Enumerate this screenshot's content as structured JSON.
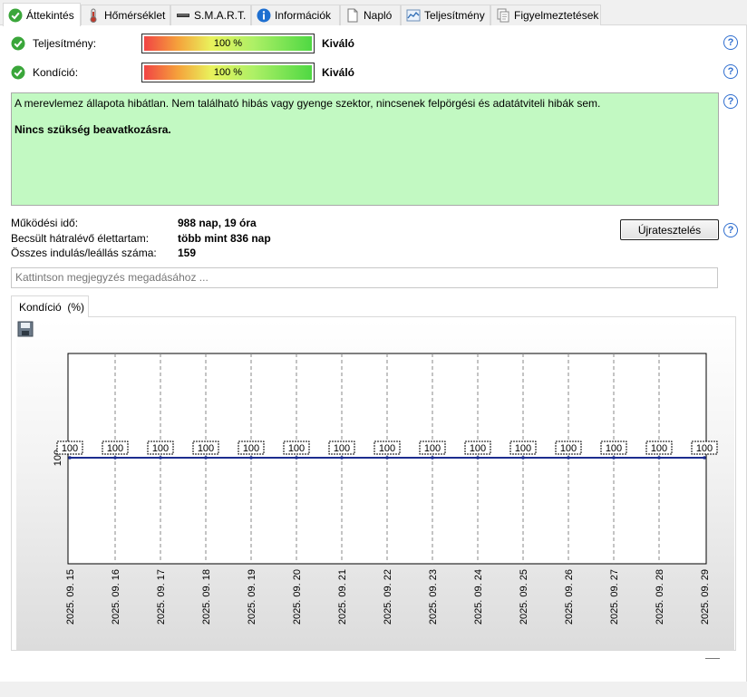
{
  "tabs": [
    {
      "label": "Áttekintés",
      "icon": "check-circle-icon",
      "active": true
    },
    {
      "label": "Hőmérséklet",
      "icon": "thermometer-icon",
      "active": false
    },
    {
      "label": "S.M.A.R.T.",
      "icon": "smart-bar-icon",
      "active": false
    },
    {
      "label": "Információk",
      "icon": "info-icon",
      "active": false
    },
    {
      "label": "Napló",
      "icon": "log-document-icon",
      "active": false
    },
    {
      "label": "Teljesítmény",
      "icon": "performance-chart-icon",
      "active": false
    },
    {
      "label": "Figyelmeztetések",
      "icon": "warnings-icon",
      "active": false
    }
  ],
  "status": {
    "performance": {
      "label": "Teljesítmény:",
      "percent_text": "100 %",
      "fill_fraction": 1.0,
      "rating": "Kiváló"
    },
    "health": {
      "label": "Kondíció:",
      "percent_text": "100 %",
      "fill_fraction": 1.0,
      "rating": "Kiváló"
    }
  },
  "message": {
    "line1": "A merevlemez állapota hibátlan. Nem található hibás vagy gyenge szektor, nincsenek felpörgési és adatátviteli hibák sem.",
    "line2": "Nincs szükség beavatkozásra.",
    "background": "#c2f9c2"
  },
  "info": [
    {
      "key": "Működési idő:",
      "value": "988 nap, 19 óra"
    },
    {
      "key": "Becsült hátralévő élettartam:",
      "value": "több mint 836 nap"
    },
    {
      "key": "Összes indulás/leállás száma:",
      "value": "159"
    }
  ],
  "retest_label": "Újratesztelés",
  "help_glyph": "?",
  "note_placeholder": "Kattintson megjegyzés megadásához ...",
  "chart_tab_label": "Kondíció  (%)",
  "colors": {
    "line": "#1c2d8f",
    "accent_check": "#3aa63a",
    "help": "#2f6ecf"
  },
  "chart_data": {
    "type": "line",
    "x": [
      "2025. 09. 15",
      "2025. 09. 16",
      "2025. 09. 17",
      "2025. 09. 18",
      "2025. 09. 19",
      "2025. 09. 20",
      "2025. 09. 21",
      "2025. 09. 22",
      "2025. 09. 23",
      "2025. 09. 24",
      "2025. 09. 25",
      "2025. 09. 26",
      "2025. 09. 27",
      "2025. 09. 28",
      "2025. 09. 29"
    ],
    "series": [
      {
        "values": [
          100,
          100,
          100,
          100,
          100,
          100,
          100,
          100,
          100,
          100,
          100,
          100,
          100,
          100,
          100
        ]
      }
    ],
    "y_tick_labels": [
      "100"
    ],
    "data_labels": true,
    "grid": "vertical dashed",
    "title": "",
    "xlabel": "",
    "ylabel": ""
  }
}
